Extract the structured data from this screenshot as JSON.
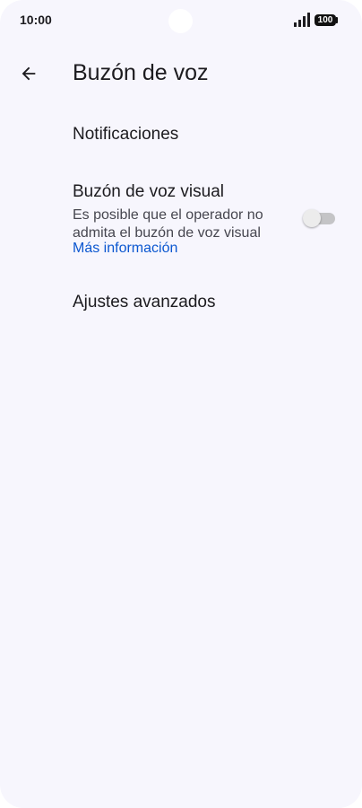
{
  "status_bar": {
    "time": "10:00",
    "battery": "100"
  },
  "header": {
    "title": "Buzón de voz"
  },
  "settings": {
    "notifications": {
      "label": "Notificaciones"
    },
    "visual_voicemail": {
      "label": "Buzón de voz visual",
      "summary": "Es posible que el operador no admita el buzón de voz visual",
      "link": "Más información",
      "enabled": false
    },
    "advanced": {
      "label": "Ajustes avanzados"
    }
  },
  "colors": {
    "background": "#f7f6fd",
    "text_primary": "#1c1b1f",
    "text_secondary": "#46464f",
    "link": "#0b57d0"
  },
  "icons": {
    "back": "arrow-back-icon",
    "signal": "signal-icon",
    "battery": "battery-icon"
  }
}
